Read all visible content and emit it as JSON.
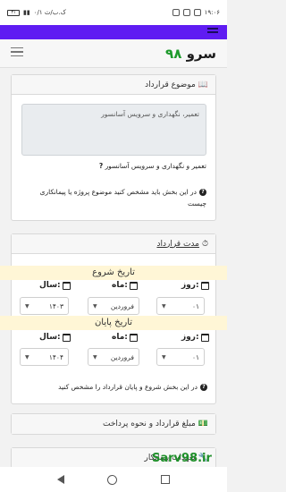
{
  "statusbar": {
    "time": "۱۹:۰۶",
    "carrier": "۰/۱ ک.ب/ث",
    "battery": "۳۱"
  },
  "app": {
    "logo_name": "سرو",
    "logo_number": "۹۸"
  },
  "subject_card": {
    "title": "موضوع قرارداد",
    "textarea_value": "تعمیر، نگهداری و سرویس آسانسور",
    "summary": "تعمیر و نگهداری و سرویس آسانسور",
    "hint": "در این بخش باید مشخص کنید موضوع پروژه یا پیمانکاری چیست"
  },
  "duration_card": {
    "title": "مدت قرارداد",
    "start_title": "تاریخ شروع",
    "end_title": "تاریخ پایان",
    "day_label": "روز:",
    "month_label": "ماه:",
    "year_label": "سال:",
    "start": {
      "day": "۰۱",
      "month": "فروردین",
      "year": "۱۴۰۳"
    },
    "end": {
      "day": "۰۱",
      "month": "فروردین",
      "year": "۱۴۰۴"
    },
    "hint": "در این بخش شروع و پایان قرارداد را مشخص کنید"
  },
  "payment_card": {
    "title": "مبلغ قرارداد و نحوه پرداخت"
  },
  "contractor_card": {
    "title": "تعهدات پیمانکار"
  },
  "watermark": "Sarv98.ir"
}
